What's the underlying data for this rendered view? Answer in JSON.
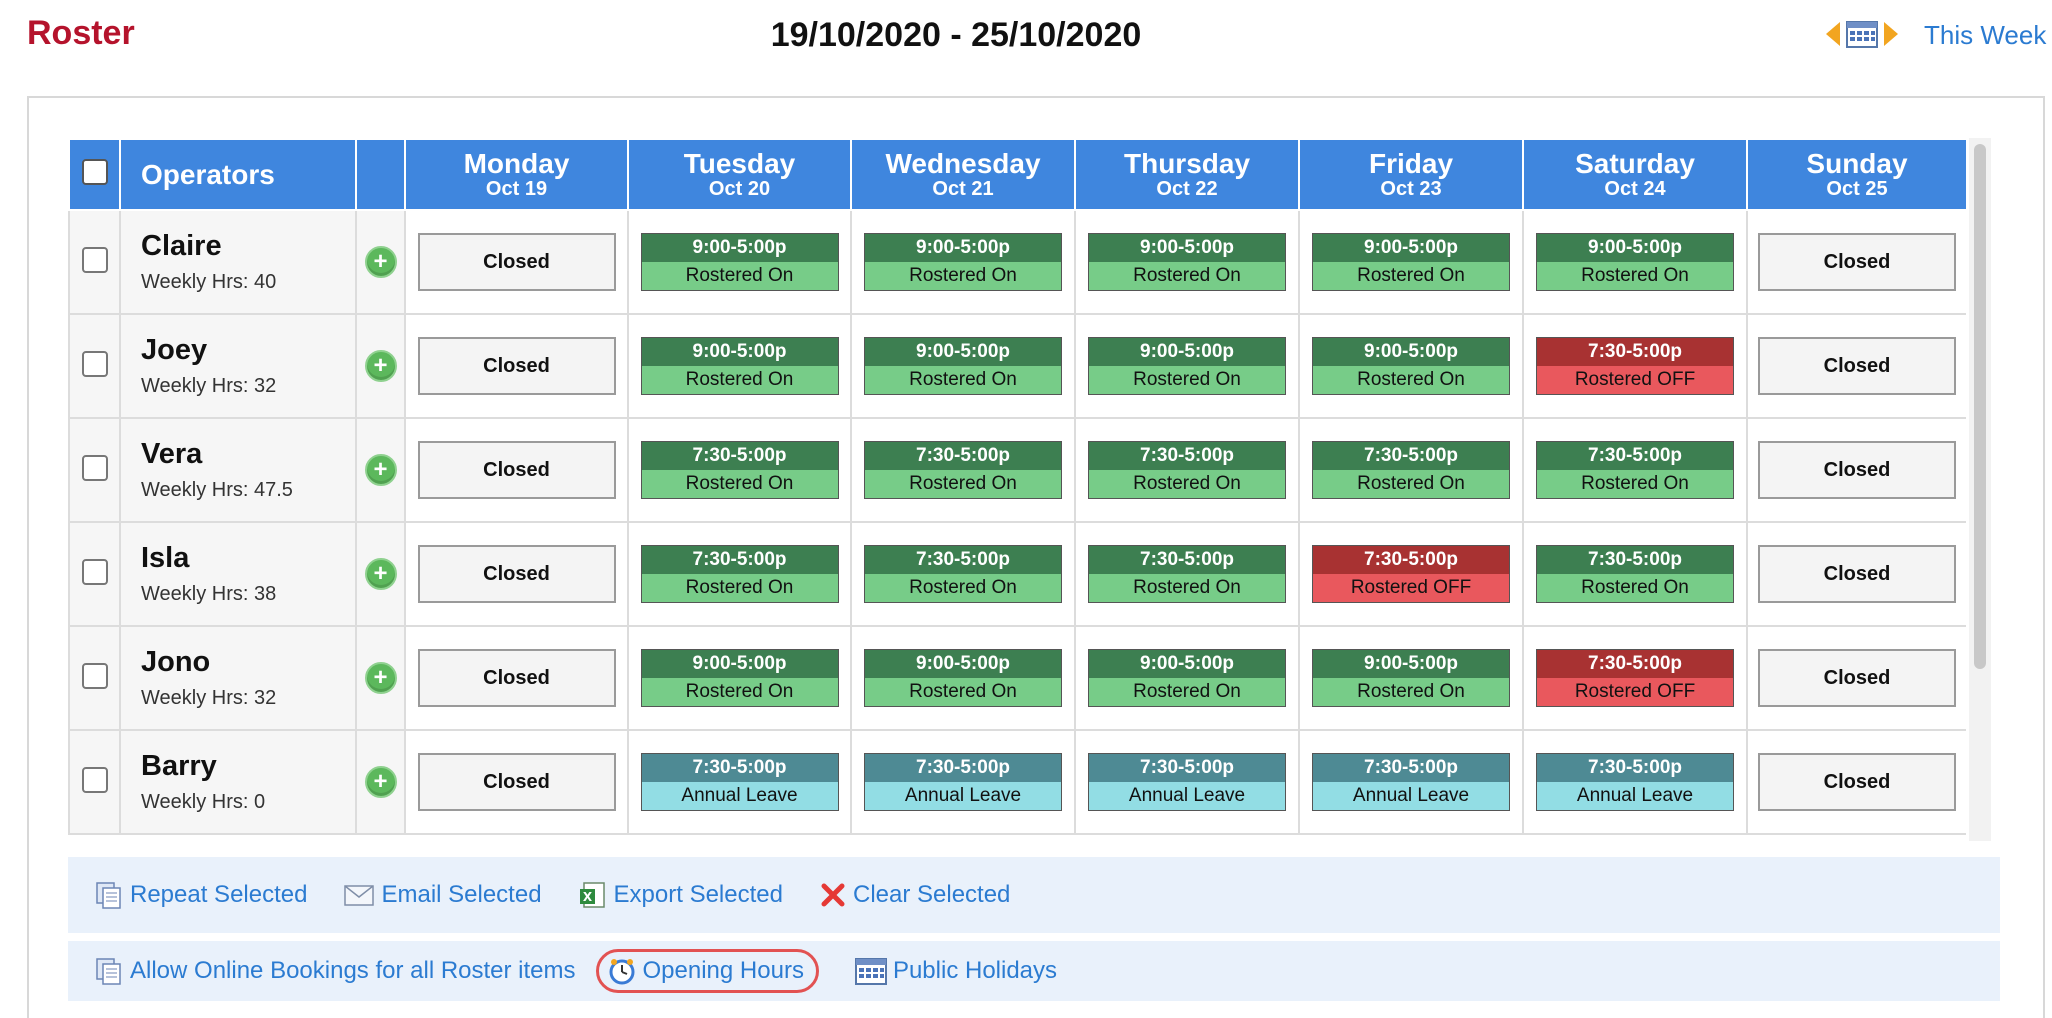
{
  "header": {
    "title": "Roster",
    "date_range": "19/10/2020 - 25/10/2020",
    "this_week_label": "This Week"
  },
  "table": {
    "operators_header": "Operators",
    "days": [
      {
        "name": "Monday",
        "date": "Oct 19"
      },
      {
        "name": "Tuesday",
        "date": "Oct 20"
      },
      {
        "name": "Wednesday",
        "date": "Oct 21"
      },
      {
        "name": "Thursday",
        "date": "Oct 22"
      },
      {
        "name": "Friday",
        "date": "Oct 23"
      },
      {
        "name": "Saturday",
        "date": "Oct 24"
      },
      {
        "name": "Sunday",
        "date": "Oct 25"
      }
    ],
    "rows": [
      {
        "name": "Claire",
        "hours": "Weekly Hrs: 40",
        "cells": [
          {
            "type": "closed",
            "label": "Closed"
          },
          {
            "type": "on",
            "time": "9:00-5:00p",
            "status": "Rostered On"
          },
          {
            "type": "on",
            "time": "9:00-5:00p",
            "status": "Rostered On"
          },
          {
            "type": "on",
            "time": "9:00-5:00p",
            "status": "Rostered On"
          },
          {
            "type": "on",
            "time": "9:00-5:00p",
            "status": "Rostered On"
          },
          {
            "type": "on",
            "time": "9:00-5:00p",
            "status": "Rostered On"
          },
          {
            "type": "closed",
            "label": "Closed"
          }
        ]
      },
      {
        "name": "Joey",
        "hours": "Weekly Hrs: 32",
        "cells": [
          {
            "type": "closed",
            "label": "Closed"
          },
          {
            "type": "on",
            "time": "9:00-5:00p",
            "status": "Rostered On"
          },
          {
            "type": "on",
            "time": "9:00-5:00p",
            "status": "Rostered On"
          },
          {
            "type": "on",
            "time": "9:00-5:00p",
            "status": "Rostered On"
          },
          {
            "type": "on",
            "time": "9:00-5:00p",
            "status": "Rostered On"
          },
          {
            "type": "off",
            "time": "7:30-5:00p",
            "status": "Rostered OFF"
          },
          {
            "type": "closed",
            "label": "Closed"
          }
        ]
      },
      {
        "name": "Vera",
        "hours": "Weekly Hrs: 47.5",
        "cells": [
          {
            "type": "closed",
            "label": "Closed"
          },
          {
            "type": "on",
            "time": "7:30-5:00p",
            "status": "Rostered On"
          },
          {
            "type": "on",
            "time": "7:30-5:00p",
            "status": "Rostered On"
          },
          {
            "type": "on",
            "time": "7:30-5:00p",
            "status": "Rostered On"
          },
          {
            "type": "on",
            "time": "7:30-5:00p",
            "status": "Rostered On"
          },
          {
            "type": "on",
            "time": "7:30-5:00p",
            "status": "Rostered On"
          },
          {
            "type": "closed",
            "label": "Closed"
          }
        ]
      },
      {
        "name": "Isla",
        "hours": "Weekly Hrs: 38",
        "cells": [
          {
            "type": "closed",
            "label": "Closed"
          },
          {
            "type": "on",
            "time": "7:30-5:00p",
            "status": "Rostered On"
          },
          {
            "type": "on",
            "time": "7:30-5:00p",
            "status": "Rostered On"
          },
          {
            "type": "on",
            "time": "7:30-5:00p",
            "status": "Rostered On"
          },
          {
            "type": "off",
            "time": "7:30-5:00p",
            "status": "Rostered OFF"
          },
          {
            "type": "on",
            "time": "7:30-5:00p",
            "status": "Rostered On"
          },
          {
            "type": "closed",
            "label": "Closed"
          }
        ]
      },
      {
        "name": "Jono",
        "hours": "Weekly Hrs: 32",
        "cells": [
          {
            "type": "closed",
            "label": "Closed"
          },
          {
            "type": "on",
            "time": "9:00-5:00p",
            "status": "Rostered On"
          },
          {
            "type": "on",
            "time": "9:00-5:00p",
            "status": "Rostered On"
          },
          {
            "type": "on",
            "time": "9:00-5:00p",
            "status": "Rostered On"
          },
          {
            "type": "on",
            "time": "9:00-5:00p",
            "status": "Rostered On"
          },
          {
            "type": "off",
            "time": "7:30-5:00p",
            "status": "Rostered OFF"
          },
          {
            "type": "closed",
            "label": "Closed"
          }
        ]
      },
      {
        "name": "Barry",
        "hours": "Weekly Hrs: 0",
        "cells": [
          {
            "type": "closed",
            "label": "Closed"
          },
          {
            "type": "leave",
            "time": "7:30-5:00p",
            "status": "Annual Leave"
          },
          {
            "type": "leave",
            "time": "7:30-5:00p",
            "status": "Annual Leave"
          },
          {
            "type": "leave",
            "time": "7:30-5:00p",
            "status": "Annual Leave"
          },
          {
            "type": "leave",
            "time": "7:30-5:00p",
            "status": "Annual Leave"
          },
          {
            "type": "leave",
            "time": "7:30-5:00p",
            "status": "Annual Leave"
          },
          {
            "type": "closed",
            "label": "Closed"
          }
        ]
      }
    ]
  },
  "actions": {
    "repeat": "Repeat Selected",
    "email": "Email Selected",
    "export": "Export Selected",
    "clear": "Clear Selected",
    "allow_online": "Allow Online Bookings for all Roster items",
    "opening_hours": "Opening Hours",
    "public_holidays": "Public Holidays"
  },
  "icons": {
    "prev": "chevron-left-icon",
    "calendar": "calendar-icon",
    "next": "chevron-right-icon",
    "add": "plus-circle-icon",
    "repeat": "copy-icon",
    "email": "envelope-icon",
    "export": "spreadsheet-icon",
    "clear": "x-icon",
    "allow_online": "copy-icon",
    "opening_hours": "clock-icon",
    "public_holidays": "calendar-icon"
  },
  "colors": {
    "title": "#b5132c",
    "header_bg": "#3f86de",
    "rostered_on_dark": "#3d7f51",
    "rostered_on_light": "#77cc88",
    "rostered_off_dark": "#a83232",
    "rostered_off_light": "#e9585d",
    "leave_dark": "#4e8a94",
    "leave_light": "#92dde4",
    "link": "#2b7bd1"
  }
}
